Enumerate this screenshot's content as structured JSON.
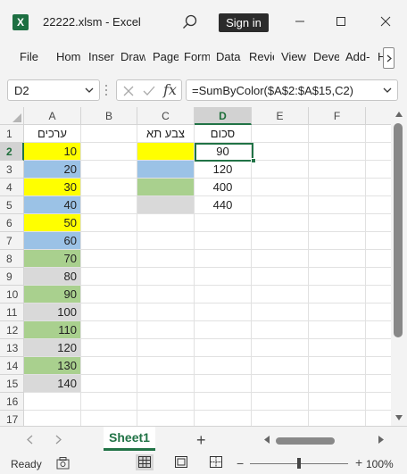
{
  "window": {
    "title": "22222.xlsm  -  Excel",
    "app_icon_letter": "X",
    "signin_label": "Sign in"
  },
  "ribbon": {
    "tabs": [
      "File",
      "Hom",
      "Inser",
      "Draw",
      "Page",
      "Form",
      "Data",
      "Revie",
      "View",
      "Deve",
      "Add-",
      "H"
    ]
  },
  "formula_bar": {
    "name_box": "D2",
    "fx_label": "fx",
    "formula": "=SumByColor($A$2:$A$15,C2)"
  },
  "grid": {
    "columns": [
      "A",
      "B",
      "C",
      "D",
      "E",
      "F"
    ],
    "rows": [
      "1",
      "2",
      "3",
      "4",
      "5",
      "6",
      "7",
      "8",
      "9",
      "10",
      "11",
      "12",
      "13",
      "14",
      "15",
      "16",
      "17"
    ],
    "active_column": "D",
    "active_row": "2",
    "header_A1": "ערכים",
    "header_C1": "צבע תא",
    "header_D1": "סכום",
    "column_a_values": [
      "10",
      "20",
      "30",
      "40",
      "50",
      "60",
      "70",
      "80",
      "90",
      "100",
      "110",
      "120",
      "130",
      "140"
    ],
    "column_a_fills": [
      "yellow",
      "blue",
      "yellow",
      "blue",
      "yellow",
      "blue",
      "green",
      "gray",
      "green",
      "gray",
      "green",
      "gray",
      "green",
      "gray"
    ],
    "column_c_fills": [
      "yellow",
      "blue",
      "green",
      "gray"
    ],
    "column_d_values": [
      "90",
      "120",
      "400",
      "440"
    ]
  },
  "colors": {
    "yellow": "#ffff00",
    "blue": "#9bc2e6",
    "green": "#a9d08e",
    "gray": "#d9d9d9",
    "accent": "#217346"
  },
  "sheets": {
    "active": "Sheet1",
    "add_label": "+"
  },
  "status": {
    "ready": "Ready",
    "zoom": "100%",
    "zoom_minus": "−",
    "zoom_plus": "+"
  }
}
